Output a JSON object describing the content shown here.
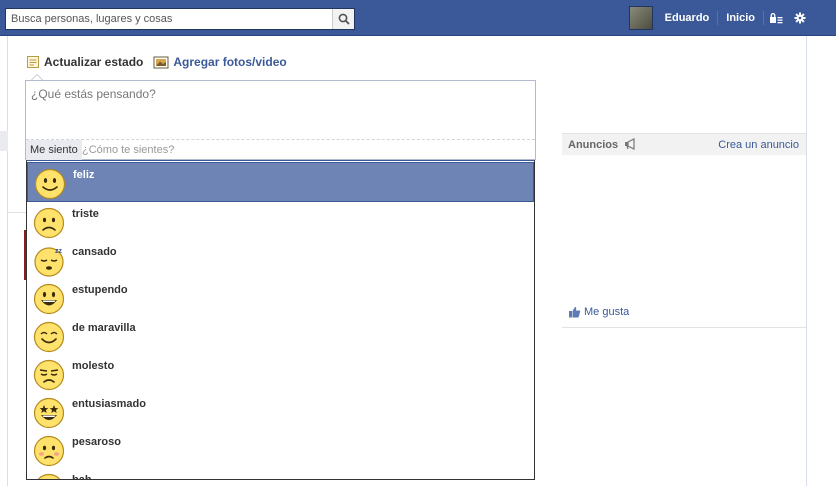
{
  "topbar": {
    "search": {
      "placeholder": "Busca personas, lugares y cosas"
    },
    "user": {
      "name": "Eduardo",
      "home": "Inicio"
    },
    "icons": [
      "search-icon",
      "lock-menu-icon",
      "gear-icon"
    ],
    "color": "#3b5998"
  },
  "composer": {
    "tabs": [
      {
        "label": "Actualizar estado",
        "icon": "status-note-icon"
      },
      {
        "label": "Agregar fotos/video",
        "icon": "photo-icon"
      }
    ],
    "status_placeholder": "¿Qué estás pensando?",
    "feeling_label": "Me siento",
    "feeling_placeholder": "¿Cómo te sientes?"
  },
  "feelings": {
    "items": [
      {
        "label": "feliz",
        "icon": "happy-face-icon",
        "selected": true
      },
      {
        "label": "triste",
        "icon": "sad-face-icon"
      },
      {
        "label": "cansado",
        "icon": "tired-face-icon"
      },
      {
        "label": "estupendo",
        "icon": "great-face-icon"
      },
      {
        "label": "de maravilla",
        "icon": "wonderful-face-icon"
      },
      {
        "label": "molesto",
        "icon": "annoyed-face-icon"
      },
      {
        "label": "entusiasmado",
        "icon": "excited-face-icon"
      },
      {
        "label": "pesaroso",
        "icon": "sorry-face-icon"
      },
      {
        "label": "bah",
        "icon": "meh-face-icon"
      }
    ],
    "highlight_color": "#6d84b4"
  },
  "sidebar": {
    "ads_title": "Anuncios",
    "create_ad": "Crea un anuncio",
    "like_label": "Me gusta"
  }
}
